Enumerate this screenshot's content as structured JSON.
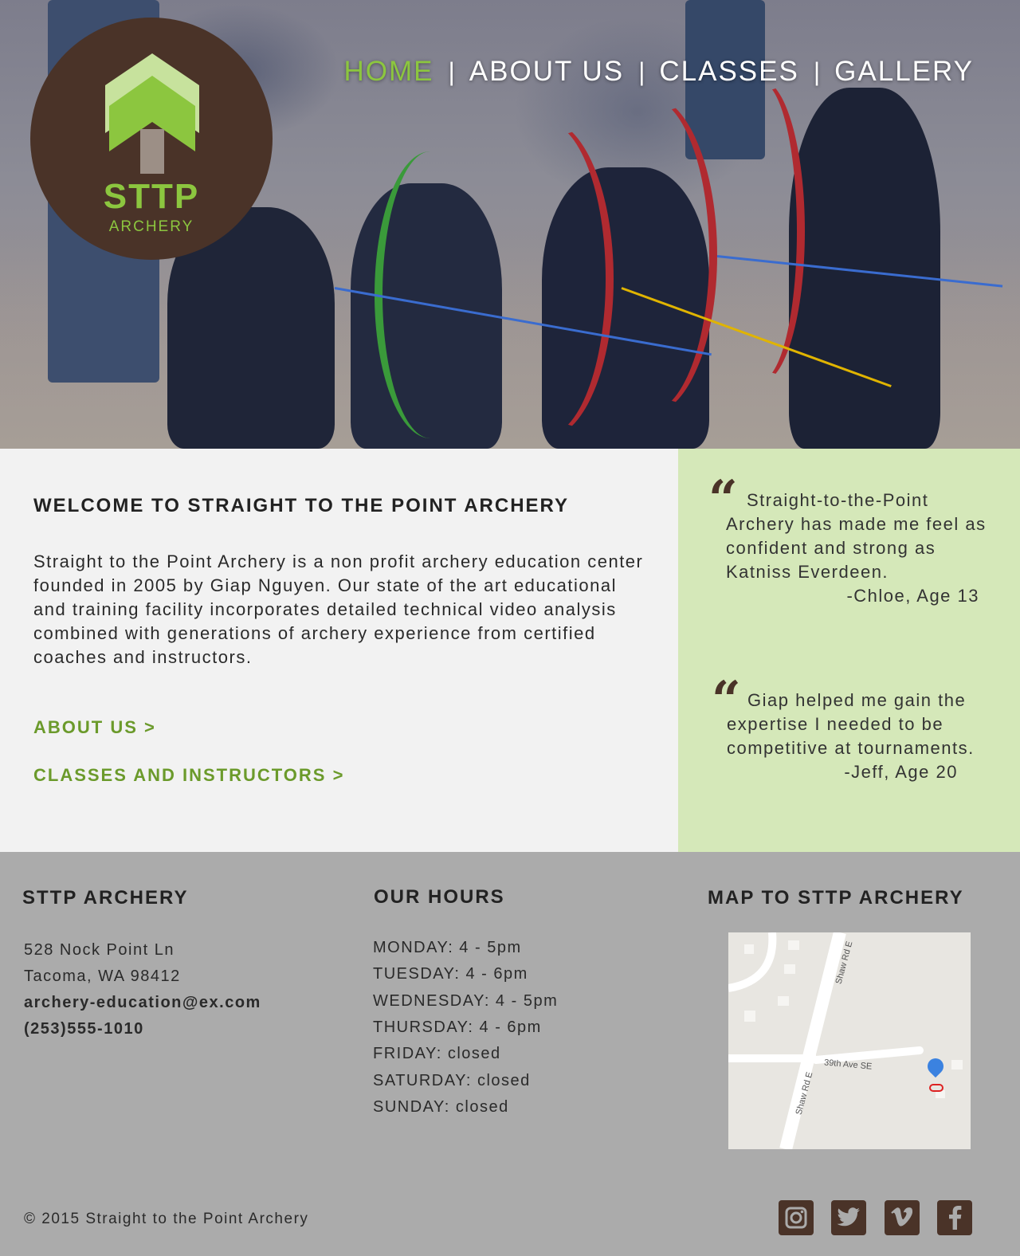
{
  "logo": {
    "title": "STTP",
    "subtitle": "ARCHERY"
  },
  "nav": {
    "items": [
      {
        "label": "HOME",
        "active": true
      },
      {
        "label": "ABOUT US",
        "active": false
      },
      {
        "label": "CLASSES",
        "active": false
      },
      {
        "label": "GALLERY",
        "active": false
      }
    ],
    "separator": "|"
  },
  "welcome": {
    "title": "WELCOME TO STRAIGHT TO THE POINT ARCHERY",
    "body": "Straight to the Point Archery is a non profit archery education center founded in 2005 by Giap Nguyen. Our state of the art educational and training facility incorporates detailed technical video analysis combined with generations of archery experience from certified coaches and instructors.",
    "about_link": "ABOUT US >",
    "classes_link": "CLASSES AND INSTRUCTORS >"
  },
  "testimonials": [
    {
      "quote": "Straight-to-the-Point Archery has made me feel as confident and strong as Katniss Everdeen.",
      "author": "-Chloe, Age 13"
    },
    {
      "quote": "Giap helped me gain the expertise I needed to be competitive at tournaments.",
      "author": "-Jeff, Age 20"
    }
  ],
  "footer": {
    "contact": {
      "heading": "STTP ARCHERY",
      "address1": "528 Nock Point Ln",
      "address2": "Tacoma, WA 98412",
      "email": "archery-education@ex.com",
      "phone": "(253)555-1010"
    },
    "hours": {
      "heading": "OUR HOURS",
      "days": [
        "MONDAY: 4 - 5pm",
        "TUESDAY: 4 - 6pm",
        "WEDNESDAY: 4 - 5pm",
        "THURSDAY: 4 - 6pm",
        "FRIDAY: closed",
        "SATURDAY: closed",
        "SUNDAY: closed"
      ]
    },
    "map": {
      "heading": "MAP TO STTP ARCHERY",
      "street1": "Shaw Rd E",
      "street2": "39th Ave SE",
      "street3": "Shaw Rd E"
    },
    "copyright": "© 2015 Straight to the Point Archery",
    "social": [
      "instagram-icon",
      "twitter-icon",
      "vimeo-icon",
      "facebook-icon"
    ]
  },
  "colors": {
    "accent_green": "#8cc63f",
    "link_green": "#6b9a2b",
    "brown": "#4a3328",
    "testimonial_bg": "#d5e8b9",
    "footer_bg": "#ababab",
    "main_bg": "#f2f2f2"
  }
}
